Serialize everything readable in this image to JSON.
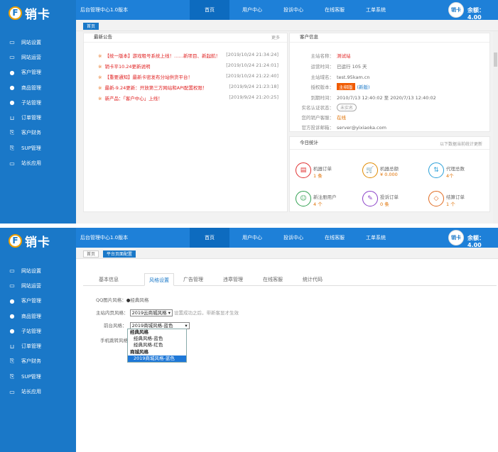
{
  "brand": {
    "logo_letter": "F",
    "name": "销卡"
  },
  "header": {
    "title": "后台管理中心1.0版本",
    "nav": [
      "首页",
      "用户中心",
      "投诉中心",
      "在线客服",
      "工单系统"
    ],
    "avatar_text": "销卡",
    "balance": "余额：4.00"
  },
  "sidebar": {
    "items": [
      {
        "icon": "▭",
        "label": "网站设置"
      },
      {
        "icon": "▭",
        "label": "网站运营"
      },
      {
        "icon": "●",
        "label": "客户管理"
      },
      {
        "icon": "●",
        "label": "商品管理"
      },
      {
        "icon": "●",
        "label": "子站管理"
      },
      {
        "icon": "⊔",
        "label": "订单管理"
      },
      {
        "icon": "⎘",
        "label": "客户财务"
      },
      {
        "icon": "⎘",
        "label": "SUP管理"
      },
      {
        "icon": "▭",
        "label": "站长应用"
      }
    ]
  },
  "top_panel": {
    "tabs": [
      "首页"
    ],
    "notice": {
      "title": "最新公告",
      "more": "更多",
      "items": [
        {
          "text": "【统一版本】游戏租号系统上线！……新项目、新起航！",
          "date": "[2019/10/24 21:34:24]"
        },
        {
          "text": "销卡平10.24更新说明",
          "date": "[2019/10/24 21:24:01]"
        },
        {
          "text": "【重要通知】最新卡密发布分站供货平台！",
          "date": "[2019/10/24 21:22:40]"
        },
        {
          "text": "最新-9.24更新：开放第三方网站和API配置权限！",
          "date": "[2019/9/24 21:23:18]"
        },
        {
          "text": "新产品：「客户中心」上线！",
          "date": "[2019/9/24 21:20:25]"
        }
      ]
    },
    "account": {
      "title": "客户信息",
      "rows": [
        {
          "k": "主站名称：",
          "v": "测试站"
        },
        {
          "k": "运营时间：",
          "v": "已运行 105 天"
        },
        {
          "k": "主站域名：",
          "v": "test.95kam.cn"
        },
        {
          "k": "授权版本：",
          "badge": "主绑版",
          "v": "(新版)"
        },
        {
          "k": "到期时间：",
          "v": "2010/7/13 12:40:02 至 2020/7/13 12:40:02"
        },
        {
          "k": "实名认证状态：",
          "pill": "未实名"
        },
        {
          "k": "您的销户客服：",
          "v": "在线"
        },
        {
          "k": "官方投诉邮箱：",
          "v": "server@yixiaoka.com"
        }
      ]
    },
    "stats": {
      "title": "今日统计",
      "more": "以下数据当前统计更新",
      "items": [
        {
          "icon": "▤",
          "label": "机器订单",
          "value": "1 条",
          "color": "#e03030"
        },
        {
          "icon": "🛒",
          "label": "机器总额",
          "value": "¥ 0.000",
          "color": "#e08a00"
        },
        {
          "icon": "⇅",
          "label": "代理总数",
          "value": "4个",
          "color": "#2aa0d8"
        },
        {
          "icon": "☺",
          "label": "新注册用户",
          "value": "4 个",
          "color": "#30a050"
        },
        {
          "icon": "✎",
          "label": "投诉订单",
          "value": "0 条",
          "color": "#8a40c8"
        },
        {
          "icon": "◇",
          "label": "结算订单",
          "value": "1 个",
          "color": "#e06a20"
        }
      ]
    }
  },
  "bottom_panel": {
    "tabs": [
      "首页",
      "平台页面配置"
    ],
    "content_tabs": [
      "基本信息",
      "风格设置",
      "广告管理",
      "违章管理",
      "在线客服",
      "统计代码"
    ],
    "active_tab": "风格设置",
    "qq_label": "QQ图片风格：",
    "qq_value": "经典风格",
    "mobile_template_label": "手机跳转风格：",
    "station_label": "主站内页风格：",
    "station_value": "2019云商城风格",
    "station_note": "设置成功之后，带新客显才生效",
    "front_label": "前台风格：",
    "front_value": "2019商城风格-蓝色",
    "dropdown": [
      {
        "type": "group",
        "text": "经典风格"
      },
      {
        "type": "opt",
        "text": "经典风格-蓝色"
      },
      {
        "type": "opt",
        "text": "经典风格-红色"
      },
      {
        "type": "group",
        "text": "商城风格"
      },
      {
        "type": "sel",
        "text": "2019商城风格-蓝色"
      }
    ]
  }
}
